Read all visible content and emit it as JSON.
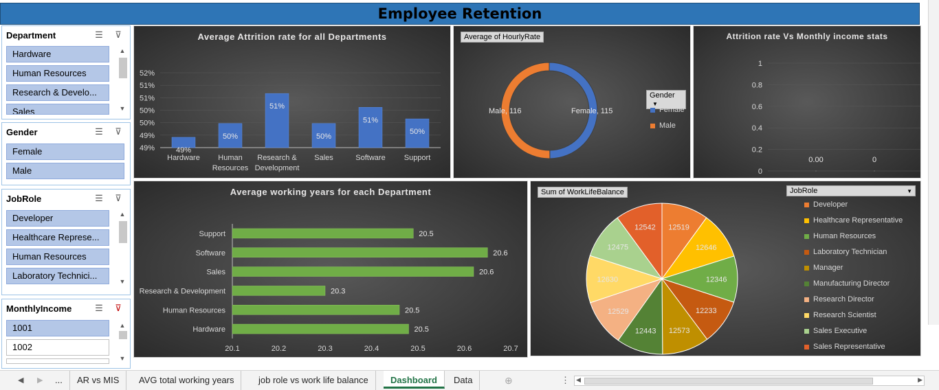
{
  "dashboard": {
    "title": "Employee Retention"
  },
  "slicers": {
    "department": {
      "title": "Department",
      "items": [
        "Hardware",
        "Human Resources",
        "Research & Develo...",
        "Sales"
      ]
    },
    "gender": {
      "title": "Gender",
      "items": [
        "Female",
        "Male"
      ]
    },
    "jobrole": {
      "title": "JobRole",
      "items": [
        "Developer",
        "Healthcare Represe...",
        "Human Resources",
        "Laboratory Technici..."
      ]
    },
    "income": {
      "title": "MonthlyIncome",
      "items": [
        "1001",
        "1002"
      ]
    }
  },
  "icons": {
    "multiselect": "multi-select-icon",
    "clear_filter": "clear-filter-icon",
    "scroll_up": "scroll-up-icon",
    "scroll_down": "scroll-down-icon"
  },
  "colors": {
    "banner": "#2e75b6",
    "bar_blue": "#4472c4",
    "bar_green": "#70ad47",
    "female": "#4472c4",
    "male": "#ed7d31",
    "slicer_selected": "#b4c7e7",
    "active_tab": "#217346"
  },
  "charts": {
    "attrition_dept": {
      "title": "Average Attrition rate for all Departments",
      "y_ticks": [
        "52%",
        "51%",
        "51%",
        "50%",
        "50%",
        "49%",
        "49%"
      ],
      "categories": [
        "Hardware",
        "Human Resources",
        "Research & Development",
        "Sales",
        "Software",
        "Support"
      ],
      "category_lines": [
        [
          "Hardware"
        ],
        [
          "Human",
          "Resources"
        ],
        [
          "Research &",
          "Development"
        ],
        [
          "Sales"
        ],
        [
          "Software"
        ],
        [
          "Support"
        ]
      ],
      "labels": [
        "49%",
        "50%",
        "51%",
        "50%",
        "51%",
        "50%"
      ]
    },
    "hourly": {
      "field_button": "Average of HourlyRate",
      "legend_button": "Gender",
      "legend": [
        "Female",
        "Male"
      ],
      "labels": [
        "Female, 115",
        "Male, 116"
      ]
    },
    "attrition_income": {
      "title": "Attrition rate Vs Monthly income stats",
      "y_ticks": [
        "1",
        "0.8",
        "0.6",
        "0.4",
        "0.2",
        "0"
      ],
      "labels": [
        "0.00",
        "0"
      ]
    },
    "working_years": {
      "title": "Average working years for each Department",
      "x_ticks": [
        "20.1",
        "20.2",
        "20.3",
        "20.4",
        "20.5",
        "20.6",
        "20.7"
      ],
      "labels": [
        "20.5",
        "20.6",
        "20.6",
        "20.3",
        "20.5",
        "20.5"
      ]
    },
    "worklife": {
      "field_button": "Sum of WorkLifeBalance",
      "legend_button": "JobRole",
      "slice_labels": [
        "12519",
        "12646",
        "12346",
        "12233",
        "12573",
        "12443",
        "12529",
        "12630",
        "12475",
        "12542"
      ]
    }
  },
  "chart_data": [
    {
      "type": "bar",
      "title": "Average Attrition rate for all Departments",
      "categories": [
        "Hardware",
        "Human Resources",
        "Research & Development",
        "Sales",
        "Software",
        "Support"
      ],
      "values": [
        49.2,
        49.8,
        51.1,
        49.8,
        50.5,
        50.0
      ],
      "ylim": [
        48.75,
        52.0
      ]
    },
    {
      "type": "pie",
      "title": "",
      "categories": [
        "Female",
        "Male"
      ],
      "values": [
        115,
        116
      ]
    },
    {
      "type": "line",
      "title": "Attrition rate Vs Monthly income stats",
      "values": [
        0,
        0
      ],
      "ylim": [
        0,
        1
      ]
    },
    {
      "type": "bar",
      "title": "Average working years for each Department",
      "categories": [
        "Support",
        "Software",
        "Sales",
        "Research & Development",
        "Human Resources",
        "Hardware"
      ],
      "values": [
        20.49,
        20.65,
        20.62,
        20.3,
        20.46,
        20.48
      ],
      "xlim": [
        20.1,
        20.7
      ]
    },
    {
      "type": "pie",
      "title": "",
      "categories": [
        "Developer",
        "Healthcare Representative",
        "Human Resources",
        "Laboratory Technician",
        "Manager",
        "Manufacturing Director",
        "Research Director",
        "Research Scientist",
        "Sales Executive",
        "Sales Representative"
      ],
      "values": [
        12519,
        12646,
        12346,
        12233,
        12573,
        12443,
        12529,
        12630,
        12475,
        12542
      ]
    }
  ],
  "tabs": {
    "more": "...",
    "items": [
      "AR vs MIS",
      "AVG total working years",
      "job role vs work life balance",
      "Dashboard",
      "Data"
    ],
    "active": "Dashboard"
  }
}
